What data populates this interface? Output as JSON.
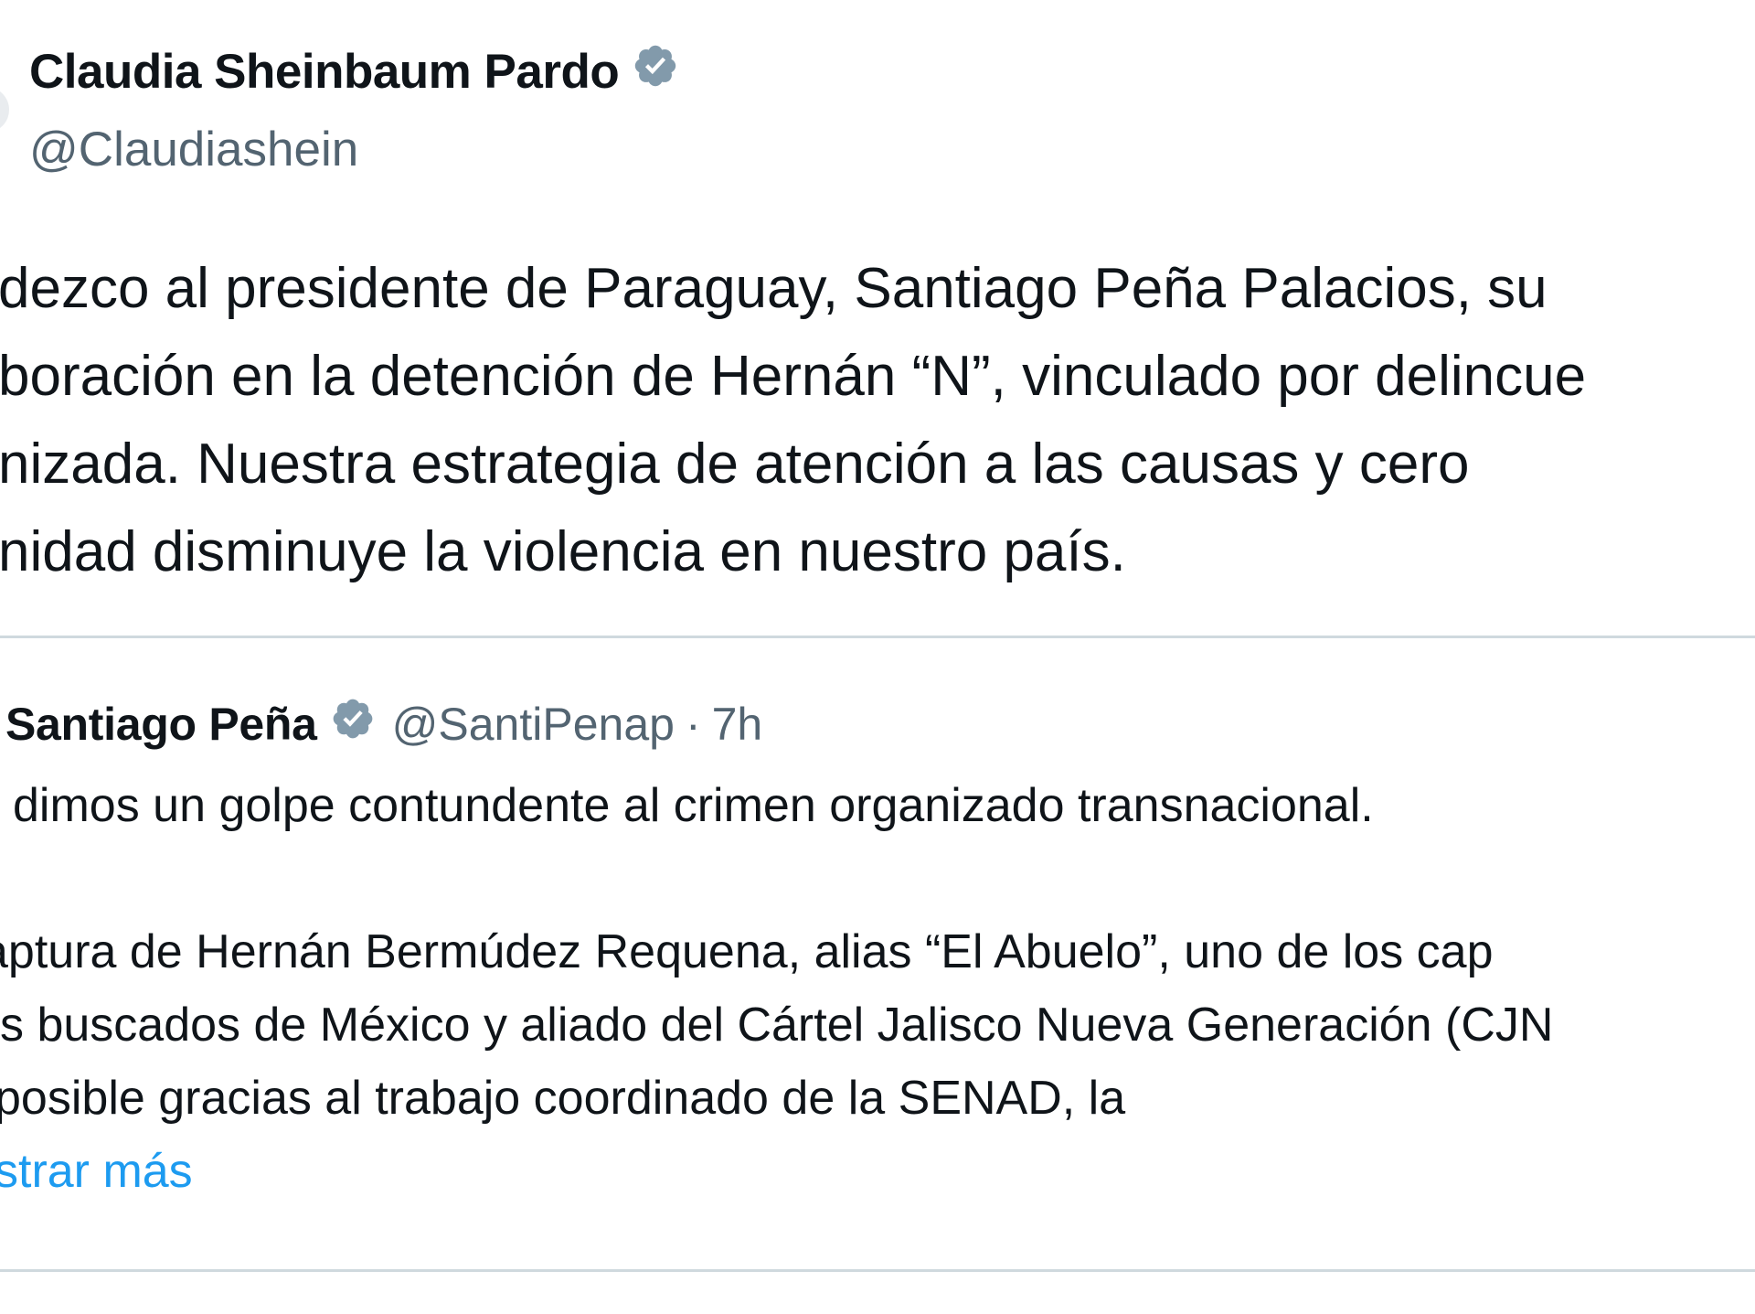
{
  "tweet": {
    "author_name": "Claudia Sheinbaum Pardo",
    "author_handle": "@Claudiashein",
    "text_lines": [
      "dezco al presidente de Paraguay, Santiago Peña Palacios, su",
      "boración en la detención de Hernán “N”, vinculado por delincue",
      "nizada. Nuestra estrategia de atención a las causas y cero",
      "nidad disminuye la violencia en nuestro país."
    ]
  },
  "quoted_tweet": {
    "author_name": "Santiago Peña",
    "author_handle": "@SantiPenap",
    "separator": "·",
    "time": "7h",
    "text_lines": [
      "dimos un golpe contundente al crimen organizado transnacional.",
      "aptura de Hernán Bermúdez Requena, alias “El Abuelo”, uno de los cap",
      "s buscados de México y aliado del Cártel Jalisco Nueva Generación (CJN",
      "posible gracias al trabajo coordinado de la SENAD, la"
    ],
    "show_more": "strar más"
  },
  "colors": {
    "text_primary": "#0f1419",
    "text_secondary": "#536471",
    "link": "#1d9bf0",
    "verified_badge": "#829aab",
    "divider": "#cfd9de"
  },
  "icons": {
    "verified": "verified-badge-icon"
  }
}
